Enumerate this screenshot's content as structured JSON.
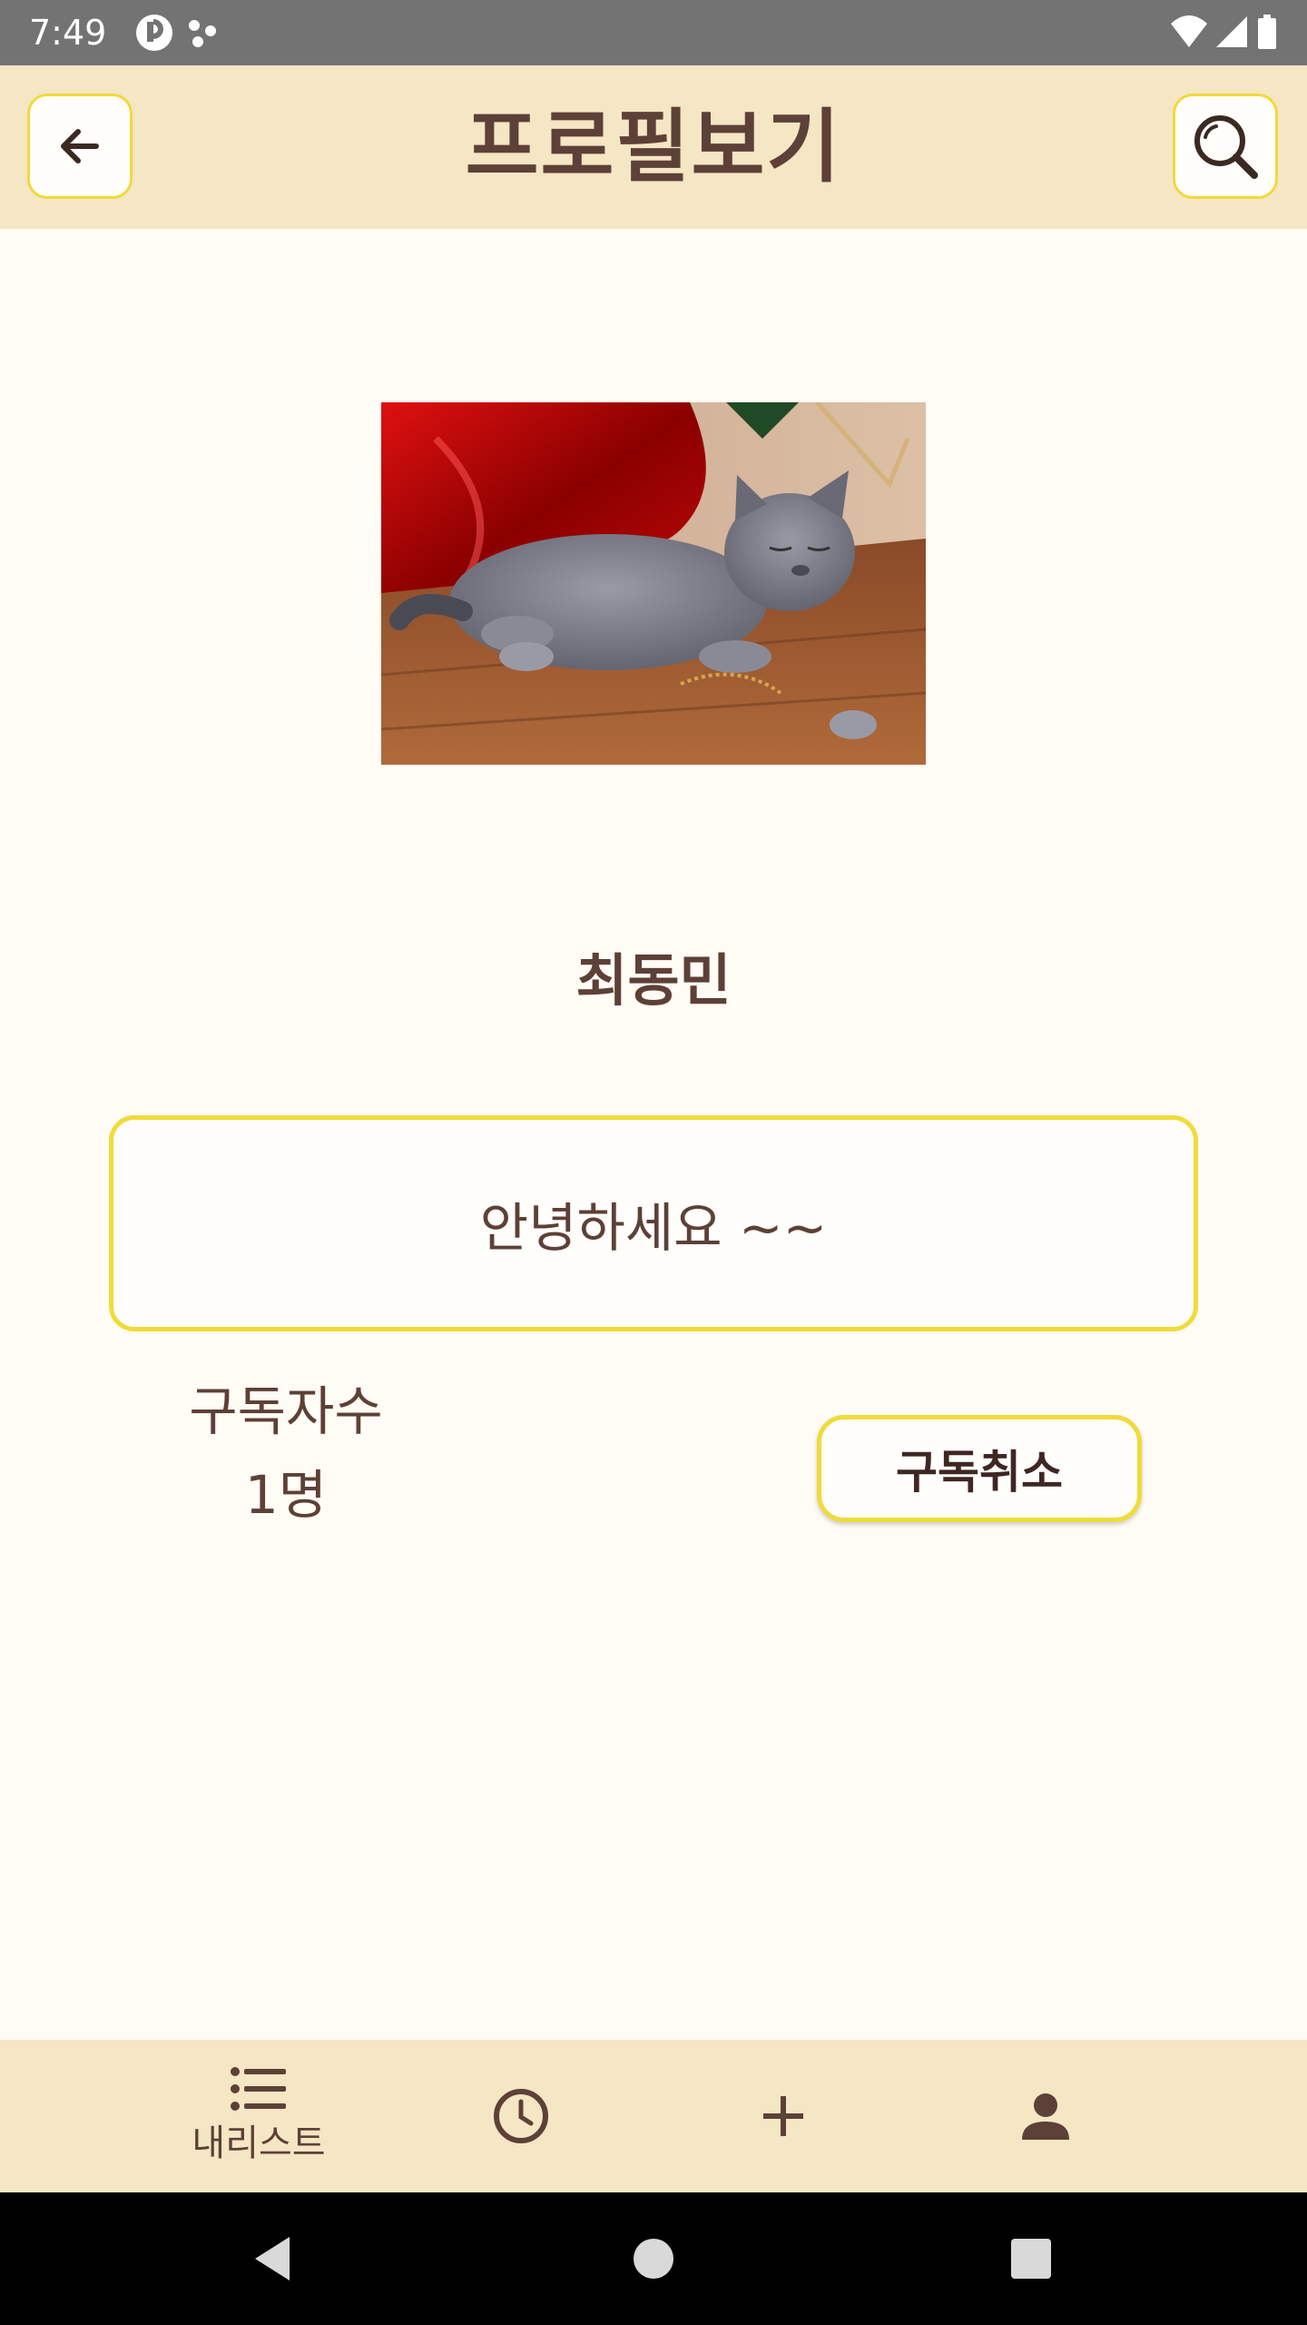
{
  "status_bar": {
    "time": "7:49",
    "icons": [
      "app-notification-icon",
      "dots-icon",
      "wifi-icon",
      "cell-signal-icon",
      "battery-icon"
    ]
  },
  "header": {
    "title": "프로필보기",
    "back_icon": "arrow-left-icon",
    "search_icon": "search-icon"
  },
  "profile": {
    "photo": "gray-cat-photo",
    "name": "최동민",
    "bio": "안녕하세요 ~~",
    "subscribers_label": "구독자수",
    "subscribers_count": "1명",
    "unsubscribe_label": "구독취소"
  },
  "bottom_nav": {
    "items": [
      {
        "icon": "list-icon",
        "label": "내리스트"
      },
      {
        "icon": "clock-icon",
        "label": ""
      },
      {
        "icon": "plus-icon",
        "label": ""
      },
      {
        "icon": "person-icon",
        "label": ""
      }
    ]
  },
  "system_nav": [
    "back-triangle-icon",
    "home-circle-icon",
    "recents-square-icon"
  ],
  "colors": {
    "background": "#fffbf5",
    "bar": "#f5e6c4",
    "accent_border": "#f0db3a",
    "text": "#5d4037"
  }
}
